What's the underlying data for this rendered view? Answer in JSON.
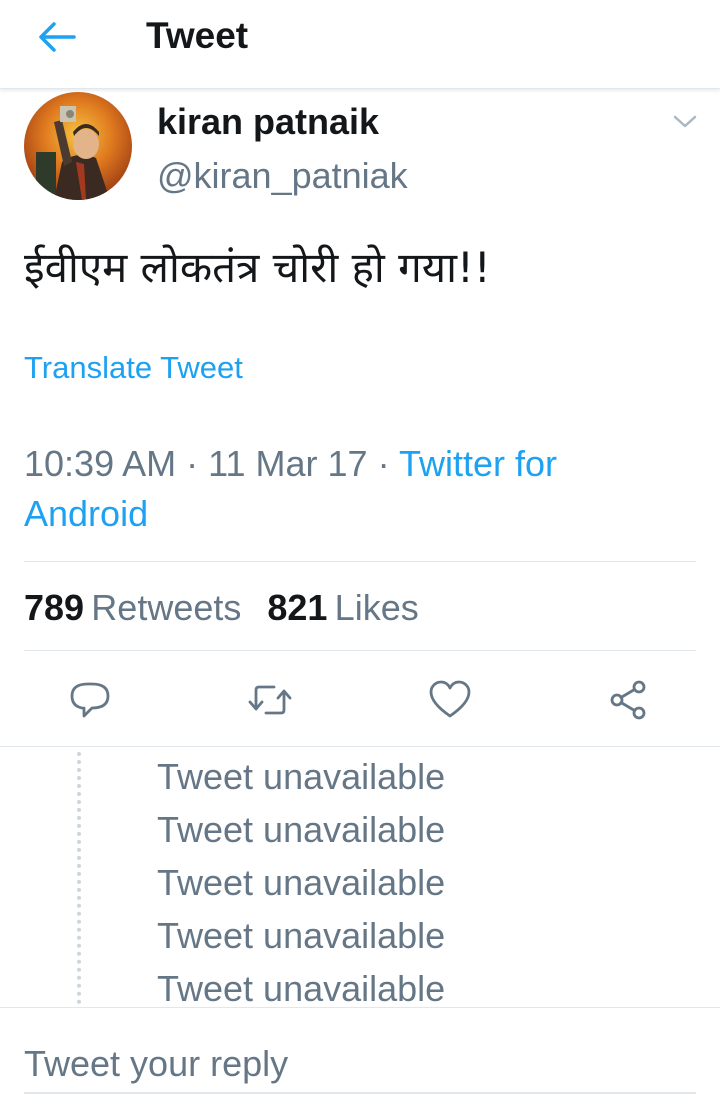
{
  "header": {
    "title": "Tweet",
    "back_icon": "back-arrow-icon"
  },
  "tweet": {
    "author_name": "kiran patnaik",
    "author_handle": "@kiran_patniak",
    "text": "ईवीएम लोकतंत्र चोरी हो गया!!",
    "translate_label": "Translate Tweet",
    "time": "10:39 AM",
    "separator": "·",
    "date": "11 Mar 17",
    "source": "Twitter for Android",
    "retweets_count": "789",
    "retweets_label": "Retweets",
    "likes_count": "821",
    "likes_label": "Likes"
  },
  "actions": {
    "icons": [
      "reply-icon",
      "retweet-icon",
      "like-icon",
      "share-icon"
    ]
  },
  "thread": {
    "items": [
      "Tweet unavailable",
      "Tweet unavailable",
      "Tweet unavailable",
      "Tweet unavailable",
      "Tweet unavailable"
    ]
  },
  "reply": {
    "placeholder": "Tweet your reply"
  },
  "colors": {
    "accent": "#1da1f2",
    "text_primary": "#14171a",
    "text_secondary": "#657786",
    "divider": "#e1e8ed"
  }
}
